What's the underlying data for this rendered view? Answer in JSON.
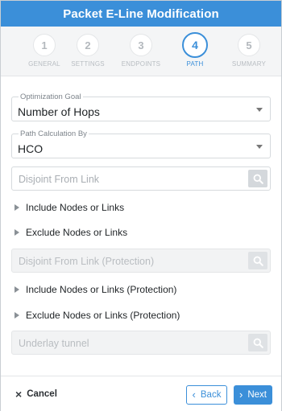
{
  "dialog": {
    "title": "Packet E-Line Modification"
  },
  "steps": [
    {
      "number": "1",
      "label": "GENERAL",
      "active": false
    },
    {
      "number": "2",
      "label": "SETTINGS",
      "active": false
    },
    {
      "number": "3",
      "label": "ENDPOINTS",
      "active": false
    },
    {
      "number": "4",
      "label": "PATH",
      "active": true
    },
    {
      "number": "5",
      "label": "SUMMARY",
      "active": false
    }
  ],
  "form": {
    "optimization_goal": {
      "label": "Optimization Goal",
      "value": "Number of Hops"
    },
    "path_calculation_by": {
      "label": "Path Calculation By",
      "value": "HCO"
    },
    "disjoint_from_link": {
      "placeholder": "Disjoint From Link"
    },
    "include_nodes": {
      "label": "Include Nodes or Links"
    },
    "exclude_nodes": {
      "label": "Exclude Nodes or Links"
    },
    "disjoint_from_link_protection": {
      "placeholder": "Disjoint From Link (Protection)"
    },
    "include_nodes_protection": {
      "label": "Include Nodes or Links (Protection)"
    },
    "exclude_nodes_protection": {
      "label": "Exclude Nodes or Links (Protection)"
    },
    "underlay_tunnel": {
      "placeholder": "Underlay tunnel"
    }
  },
  "footer": {
    "cancel_label": "Cancel",
    "back_label": "Back",
    "next_label": "Next"
  },
  "colors": {
    "accent": "#3b8fd9",
    "header_bg": "#3b8fd9",
    "stepper_bg": "#f4f5f6"
  },
  "icons": [
    "search-icon",
    "chevron-down-icon",
    "caret-right-icon",
    "close-icon",
    "chevron-left-icon",
    "chevron-right-icon"
  ]
}
